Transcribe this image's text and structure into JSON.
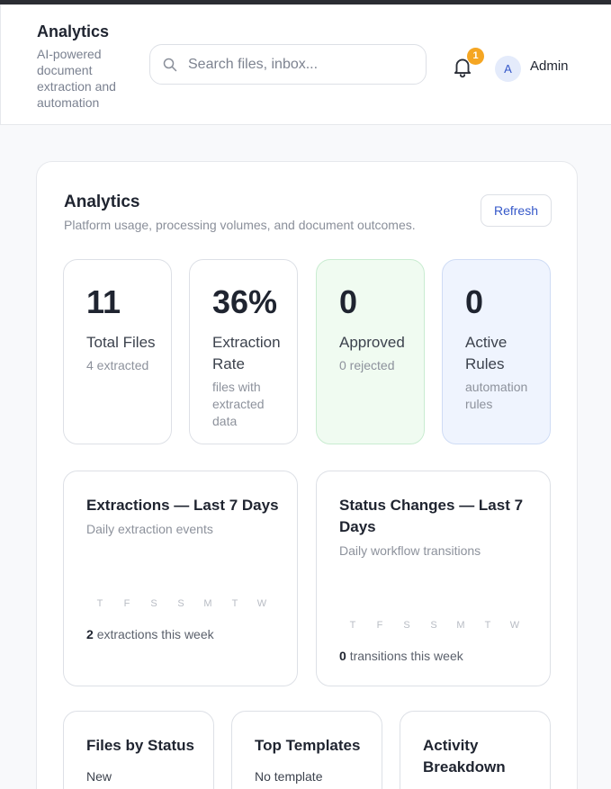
{
  "app": {
    "title": "Analytics",
    "subtitle": "AI-powered document extraction and automation"
  },
  "search": {
    "placeholder": "Search files, inbox...",
    "value": ""
  },
  "notifications": {
    "count": "1"
  },
  "user": {
    "initial": "A",
    "name": "Admin"
  },
  "page": {
    "title": "Analytics",
    "subtitle": "Platform usage, processing volumes, and document outcomes.",
    "refresh_label": "Refresh"
  },
  "stats": [
    {
      "value": "11",
      "label": "Total Files",
      "note": "4 extracted"
    },
    {
      "value": "36%",
      "label": "Extraction Rate",
      "note": "files with extracted data"
    },
    {
      "value": "0",
      "label": "Approved",
      "note": "0 rejected"
    },
    {
      "value": "0",
      "label": "Active Rules",
      "note": "automation rules"
    }
  ],
  "charts": [
    {
      "title": "Extractions — Last 7 Days",
      "subtitle": "Daily extraction events",
      "days": [
        "T",
        "F",
        "S",
        "S",
        "M",
        "T",
        "W"
      ],
      "total": "2",
      "total_suffix": "extractions this week"
    },
    {
      "title": "Status Changes — Last 7 Days",
      "subtitle": "Daily workflow transitions",
      "days": [
        "T",
        "F",
        "S",
        "S",
        "M",
        "T",
        "W"
      ],
      "total": "0",
      "total_suffix": "transitions this week"
    }
  ],
  "bottom_cards": [
    {
      "title": "Files by Status",
      "first_row": "New"
    },
    {
      "title": "Top Templates",
      "first_row": "No template"
    },
    {
      "title": "Activity Breakdown",
      "first_row": ""
    }
  ],
  "colors": {
    "accent": "#3558c9",
    "badge": "#f5a623",
    "approved_bg": "#f0fbf1",
    "rules_bg": "#eff4fe"
  }
}
